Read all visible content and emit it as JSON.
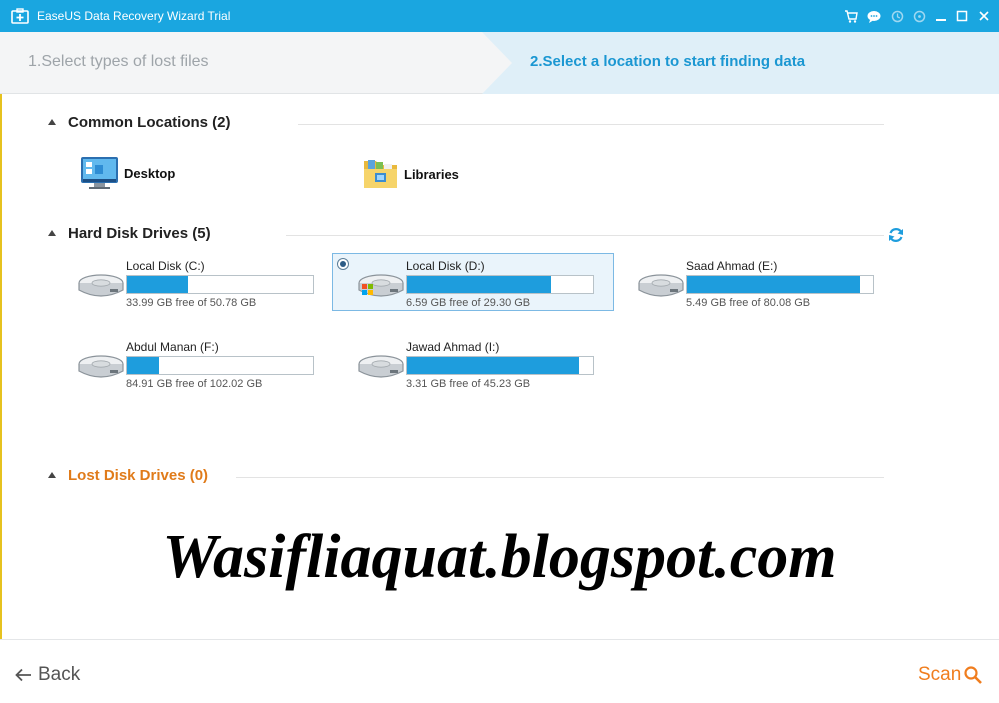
{
  "window": {
    "title": "EaseUS Data Recovery Wizard Trial",
    "controls": [
      "cart-icon",
      "chat-icon",
      "update-icon",
      "minimize-icon",
      "maximize-icon",
      "close-icon"
    ]
  },
  "steps": {
    "step1": "1.Select types of lost files",
    "step2": "2.Select a location to start finding data"
  },
  "common": {
    "title": "Common Locations (2)",
    "items": [
      {
        "label": "Desktop",
        "icon": "desktop-icon"
      },
      {
        "label": "Libraries",
        "icon": "libraries-folder-icon"
      }
    ]
  },
  "hdd": {
    "title": "Hard Disk Drives (5)",
    "drives": [
      {
        "name": "Local Disk (C:)",
        "free_text": "33.99 GB free of 50.78 GB",
        "used_fraction": 0.33,
        "selected": false
      },
      {
        "name": "Local Disk (D:)",
        "free_text": "6.59 GB free of 29.30 GB",
        "used_fraction": 0.775,
        "selected": true
      },
      {
        "name": "Saad Ahmad (E:)",
        "free_text": "5.49 GB free of 80.08 GB",
        "used_fraction": 0.93,
        "selected": false
      },
      {
        "name": "Abdul Manan (F:)",
        "free_text": "84.91 GB free of 102.02 GB",
        "used_fraction": 0.17,
        "selected": false
      },
      {
        "name": "Jawad Ahmad (I:)",
        "free_text": "3.31 GB free of 45.23 GB",
        "used_fraction": 0.925,
        "selected": false
      }
    ]
  },
  "lost": {
    "title": "Lost Disk Drives (0)"
  },
  "watermark": "Wasifliaquat.blogspot.com",
  "footer": {
    "back": "Back",
    "scan": "Scan"
  },
  "colors": {
    "titlebar": "#1aa6e0",
    "accent": "#1b97d2",
    "bar": "#1e9ddd",
    "lost_title": "#e07b1a",
    "scan": "#f07d1e"
  }
}
